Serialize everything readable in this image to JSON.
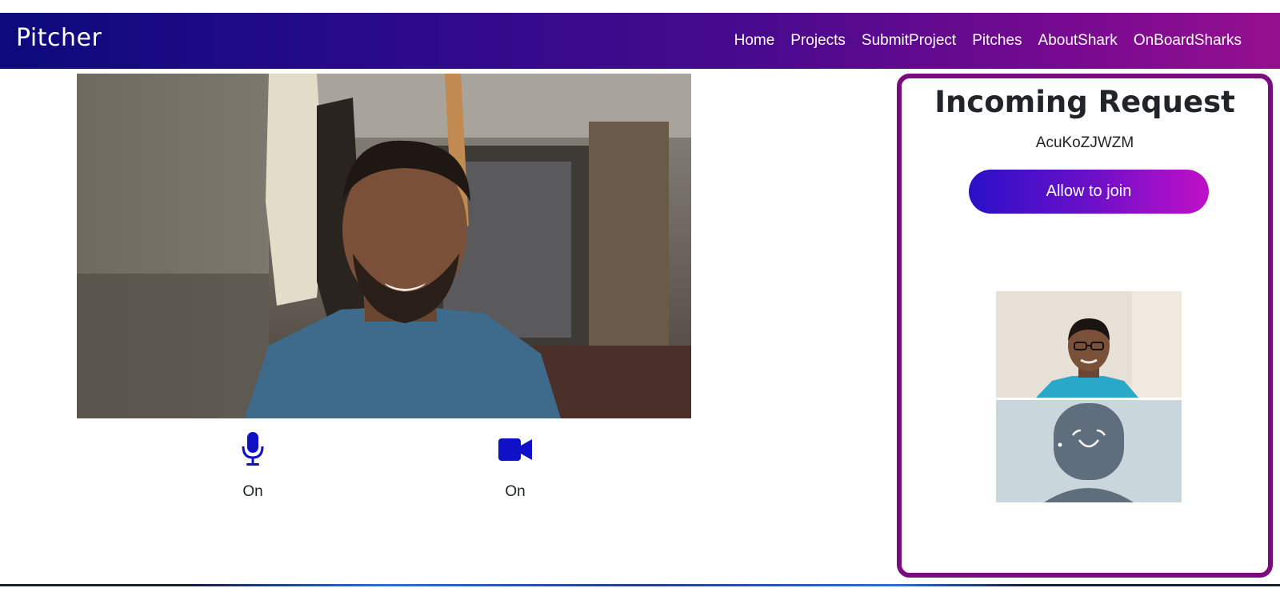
{
  "navbar": {
    "brand": "Pitcher",
    "links": [
      "Home",
      "Projects",
      "SubmitProject",
      "Pitches",
      "AboutShark",
      "OnBoardSharks"
    ]
  },
  "controls": {
    "mic": {
      "icon": "microphone-icon",
      "status": "On"
    },
    "camera": {
      "icon": "video-camera-icon",
      "status": "On"
    }
  },
  "request": {
    "title": "Incoming Request",
    "requester_id": "AcuKoZJWZM",
    "allow_button": "Allow to join"
  },
  "colors": {
    "navbar_gradient_start": "#0c0a7c",
    "navbar_gradient_end": "#95108f",
    "accent_icon": "#1010c8",
    "panel_border": "#7a0c80",
    "button_gradient_start": "#2a10c8",
    "button_gradient_end": "#c010c8"
  }
}
